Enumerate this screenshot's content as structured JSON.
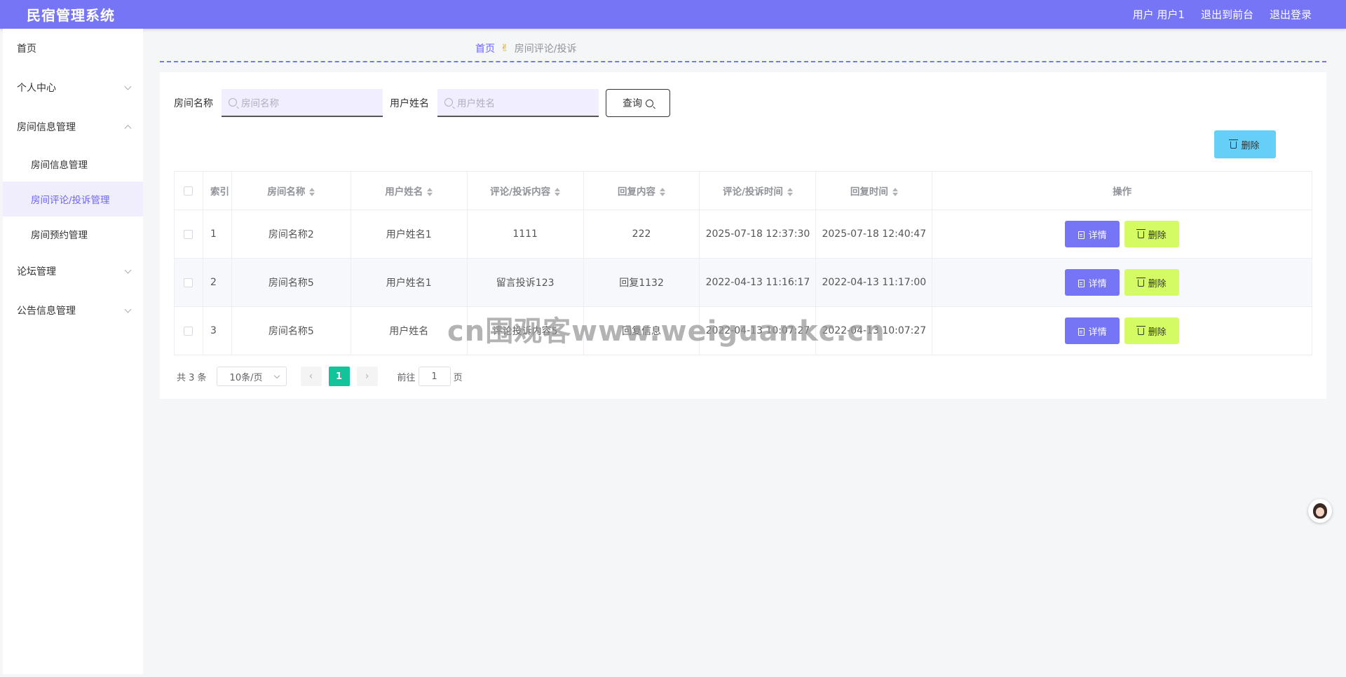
{
  "app": {
    "title": "民宿管理系统"
  },
  "topbar": {
    "user_label": "用户 用户1",
    "front_link": "退出到前台",
    "logout_link": "退出登录"
  },
  "sidebar": {
    "home": "首页",
    "personal": "个人中心",
    "room_info_group": "房间信息管理",
    "room_info": "房间信息管理",
    "room_comment": "房间评论/投诉管理",
    "room_booking": "房间预约管理",
    "forum": "论坛管理",
    "notice": "公告信息管理"
  },
  "breadcrumb": {
    "home": "首页",
    "current": "房间评论/投诉"
  },
  "search": {
    "room_label": "房间名称",
    "room_placeholder": "房间名称",
    "user_label": "用户姓名",
    "user_placeholder": "用户姓名",
    "query_button": "查询"
  },
  "bulk_delete_button": "删除",
  "table": {
    "headers": {
      "index": "索引",
      "room": "房间名称",
      "user": "用户姓名",
      "content": "评论/投诉内容",
      "reply": "回复内容",
      "comment_time": "评论/投诉时间",
      "reply_time": "回复时间",
      "actions": "操作"
    },
    "rows": [
      {
        "index": "1",
        "room": "房间名称2",
        "user": "用户姓名1",
        "content": "1111",
        "reply": "222",
        "comment_time": "2025-07-18 12:37:30",
        "reply_time": "2025-07-18 12:40:47"
      },
      {
        "index": "2",
        "room": "房间名称5",
        "user": "用户姓名1",
        "content": "留言投诉123",
        "reply": "回复1132",
        "comment_time": "2022-04-13 11:16:17",
        "reply_time": "2022-04-13 11:17:00"
      },
      {
        "index": "3",
        "room": "房间名称5",
        "user": "用户姓名",
        "content": "评论投诉内容5",
        "reply": "回复信息",
        "comment_time": "2022-04-13 10:07:27",
        "reply_time": "2022-04-13 10:07:27"
      }
    ],
    "detail_button": "详情",
    "delete_button": "删除"
  },
  "pagination": {
    "total": "共 3 条",
    "page_size": "10条/页",
    "current_page": "1",
    "goto_label": "前往",
    "goto_value": "1",
    "page_unit": "页"
  },
  "watermark": "cn围观客www.weiguankc.cn",
  "colors": {
    "brand": "#7575f5",
    "active_page": "#13c39a",
    "delete": "#d4fb63",
    "bulk_delete": "#66cff7"
  }
}
